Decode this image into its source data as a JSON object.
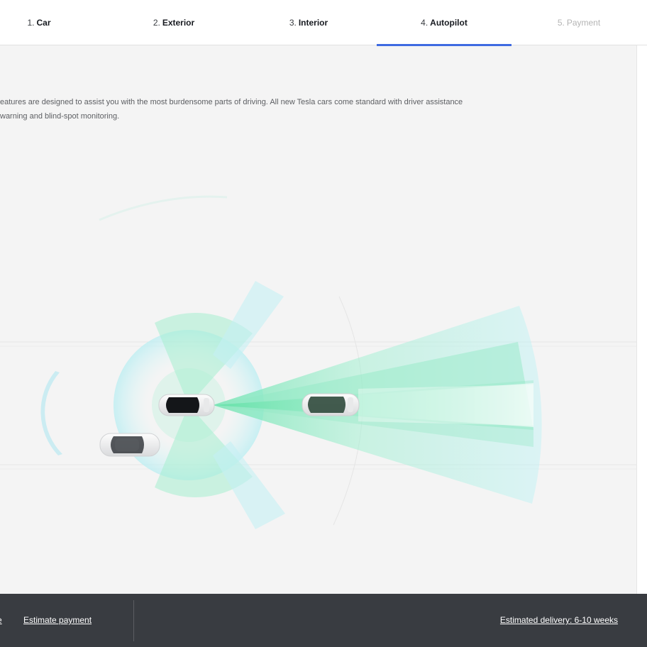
{
  "steps": [
    {
      "number": "1.",
      "label": "Car",
      "state": "done"
    },
    {
      "number": "2.",
      "label": "Exterior",
      "state": "done"
    },
    {
      "number": "3.",
      "label": "Interior",
      "state": "done"
    },
    {
      "number": "4.",
      "label": "Autopilot",
      "state": "active"
    },
    {
      "number": "5.",
      "label": "Payment",
      "state": "disabled"
    }
  ],
  "colors": {
    "active_underline": "#3e6ae1",
    "footer_bg": "#393c41",
    "sensor_green": "#7ee8b8",
    "sensor_cyan": "#a8ecf4"
  },
  "description": {
    "line1": "eatures are designed to assist you with the most burdensome parts of driving. All new Tesla cars come standard with driver assistance",
    "line2": "warning and blind-spot monitoring."
  },
  "footer": {
    "cut_link": "e",
    "estimate_payment": "Estimate payment",
    "delivery": "Estimated delivery: 6-10 weeks"
  }
}
